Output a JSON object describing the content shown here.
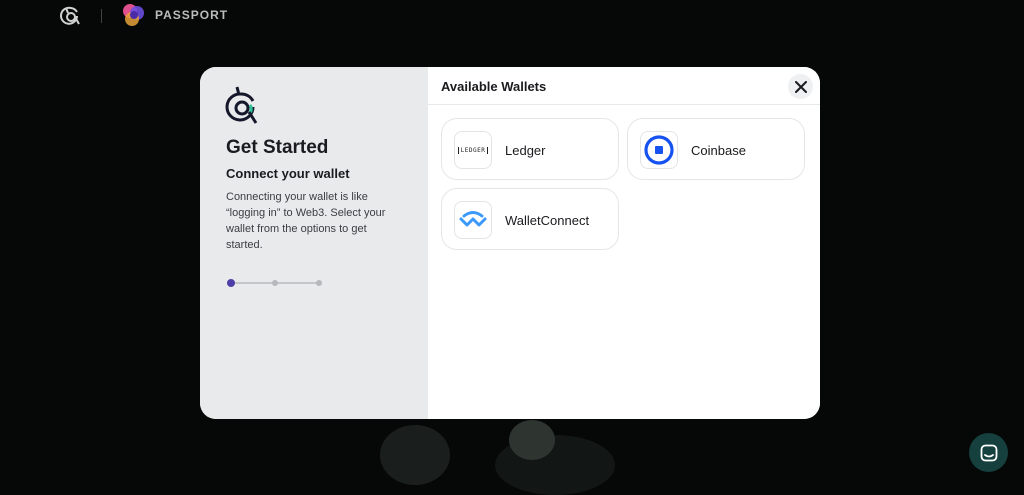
{
  "topbar": {
    "logo_icon": "gitcoin-logo-icon",
    "brand_icon": "passport-logo-icon",
    "brand_text": "PASSPORT"
  },
  "modal": {
    "left": {
      "logo_icon": "gitcoin-robot-icon",
      "title": "Get Started",
      "subtitle": "Connect your wallet",
      "description": "Connecting your wallet is like “logging in” to Web3. Select your wallet from the options to get started.",
      "steps": {
        "total": 3,
        "current": 1
      }
    },
    "right": {
      "title": "Available Wallets",
      "close_icon": "close-icon",
      "wallets": [
        {
          "label": "Ledger",
          "icon": "ledger-icon",
          "icon_text": "LEDGER"
        },
        {
          "label": "Coinbase",
          "icon": "coinbase-icon"
        },
        {
          "label": "WalletConnect",
          "icon": "walletconnect-icon"
        }
      ]
    }
  },
  "chat": {
    "icon": "chat-icon"
  },
  "colors": {
    "background": "#050807",
    "accent": "#4e3fa8",
    "coinbase": "#1652f0",
    "walletconnect": "#3b99fc",
    "chat_button": "#15403d"
  }
}
